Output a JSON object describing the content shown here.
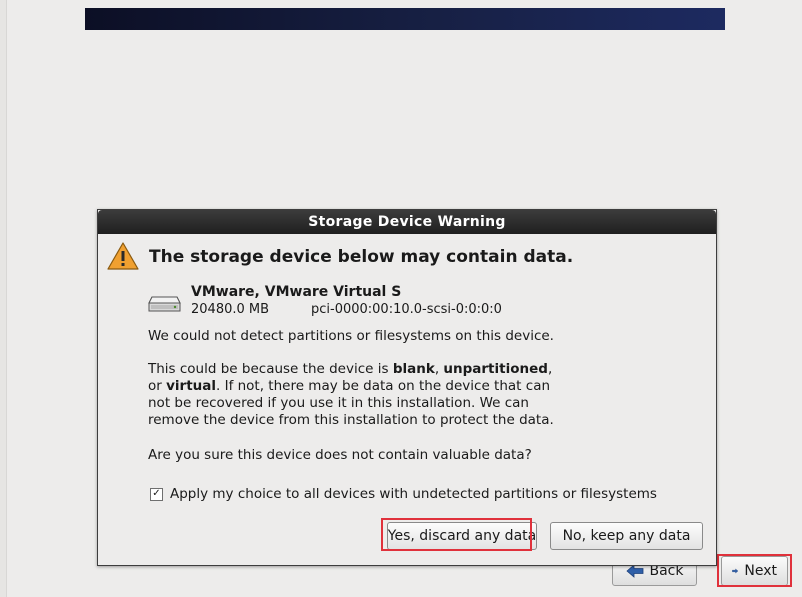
{
  "dialog": {
    "title": "Storage Device Warning",
    "headline": "The storage device below may contain data.",
    "device": {
      "name": "VMware, VMware Virtual S",
      "size": "20480.0 MB",
      "path": "pci-0000:00:10.0-scsi-0:0:0:0"
    },
    "message1": "We could not detect partitions or filesystems on this device.",
    "message2": {
      "l1_a": "This could be because the device is ",
      "l1_b": "blank",
      "l1_c": ", ",
      "l1_d": "unpartitioned",
      "l1_e": ",",
      "l2_a": "or ",
      "l2_b": "virtual",
      "l2_c": ". If not, there may be data on the device that can",
      "l3": "not be recovered if you use it in this installation. We can",
      "l4": "remove the device from this installation to protect the data."
    },
    "question": "Are you sure this device does not contain valuable data?",
    "apply_all": {
      "label": "Apply my choice to all devices with undetected partitions or filesystems",
      "checked": true,
      "check_glyph": "✓"
    },
    "buttons": {
      "discard": "Yes, discard any data",
      "keep": "No, keep any data"
    }
  },
  "nav": {
    "back": "Back",
    "next": "Next"
  },
  "colors": {
    "highlight": "#e0313b",
    "banner": "#1d2a60",
    "warning": "#f0a030",
    "arrow": "#2f5fa8"
  },
  "icons": {
    "warning": "warning-icon",
    "disk": "hard-disk-icon",
    "back": "arrow-left-icon",
    "next": "arrow-right-icon"
  }
}
